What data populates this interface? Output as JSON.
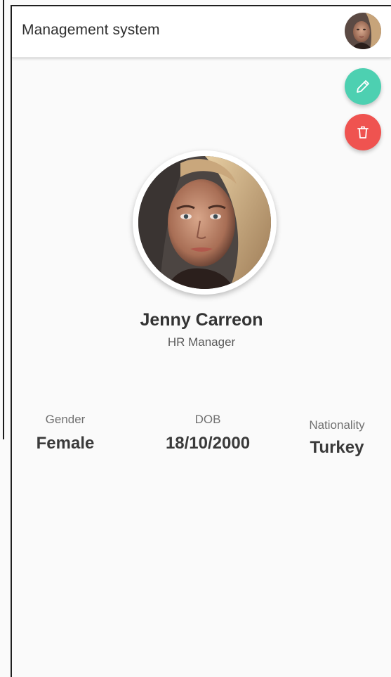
{
  "app_bar": {
    "title": "Management system",
    "avatar_icon": "user-avatar-icon"
  },
  "actions": {
    "edit_icon": "pencil-icon",
    "delete_icon": "trash-icon",
    "edit_color": "#4dd0b1",
    "delete_color": "#ef5350"
  },
  "profile": {
    "name": "Jenny Carreon",
    "role": "HR Manager"
  },
  "details": [
    {
      "label": "Gender",
      "value": "Female"
    },
    {
      "label": "DOB",
      "value": "18/10/2000"
    },
    {
      "label": "Nationality",
      "value": "Turkey"
    }
  ]
}
